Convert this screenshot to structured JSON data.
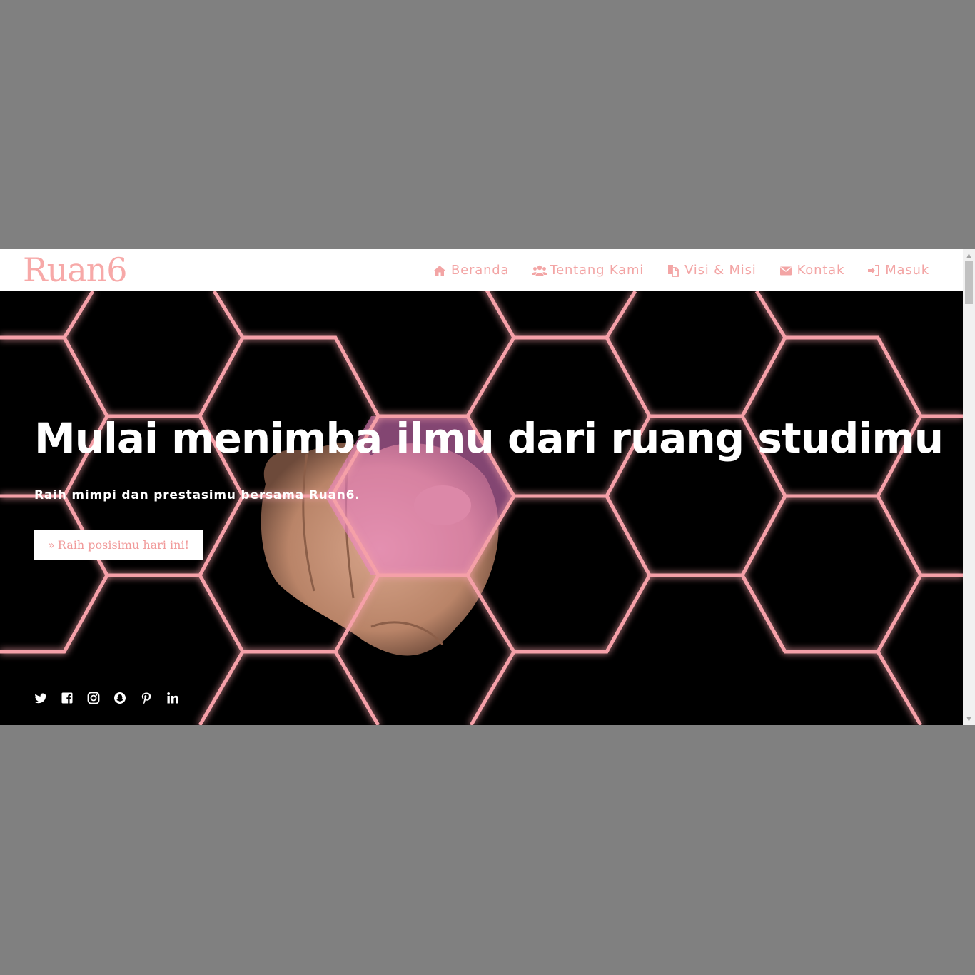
{
  "brand": {
    "logo_text": "Ruan6",
    "color": "#f7a9a8"
  },
  "nav": {
    "items": [
      {
        "label": "Beranda",
        "icon": "home-icon"
      },
      {
        "label": "Tentang Kami",
        "icon": "users-icon"
      },
      {
        "label": "Visi & Misi",
        "icon": "files-icon"
      },
      {
        "label": "Kontak",
        "icon": "envelope-icon"
      },
      {
        "label": "Masuk",
        "icon": "sign-in-icon"
      }
    ],
    "color": "#f3a5a5"
  },
  "hero": {
    "headline": "Mulai menimba ilmu dari ruang studimu",
    "subline": "Raih mimpi dan prestasimu bersama Ruan6.",
    "cta_label": "Raih posisimu hari ini!",
    "cta_icon": "double-chevron-right-icon",
    "background": "hexagon-network-hand-image"
  },
  "social": [
    "twitter-icon",
    "facebook-icon",
    "instagram-icon",
    "snapchat-icon",
    "pinterest-icon",
    "linkedin-icon"
  ]
}
